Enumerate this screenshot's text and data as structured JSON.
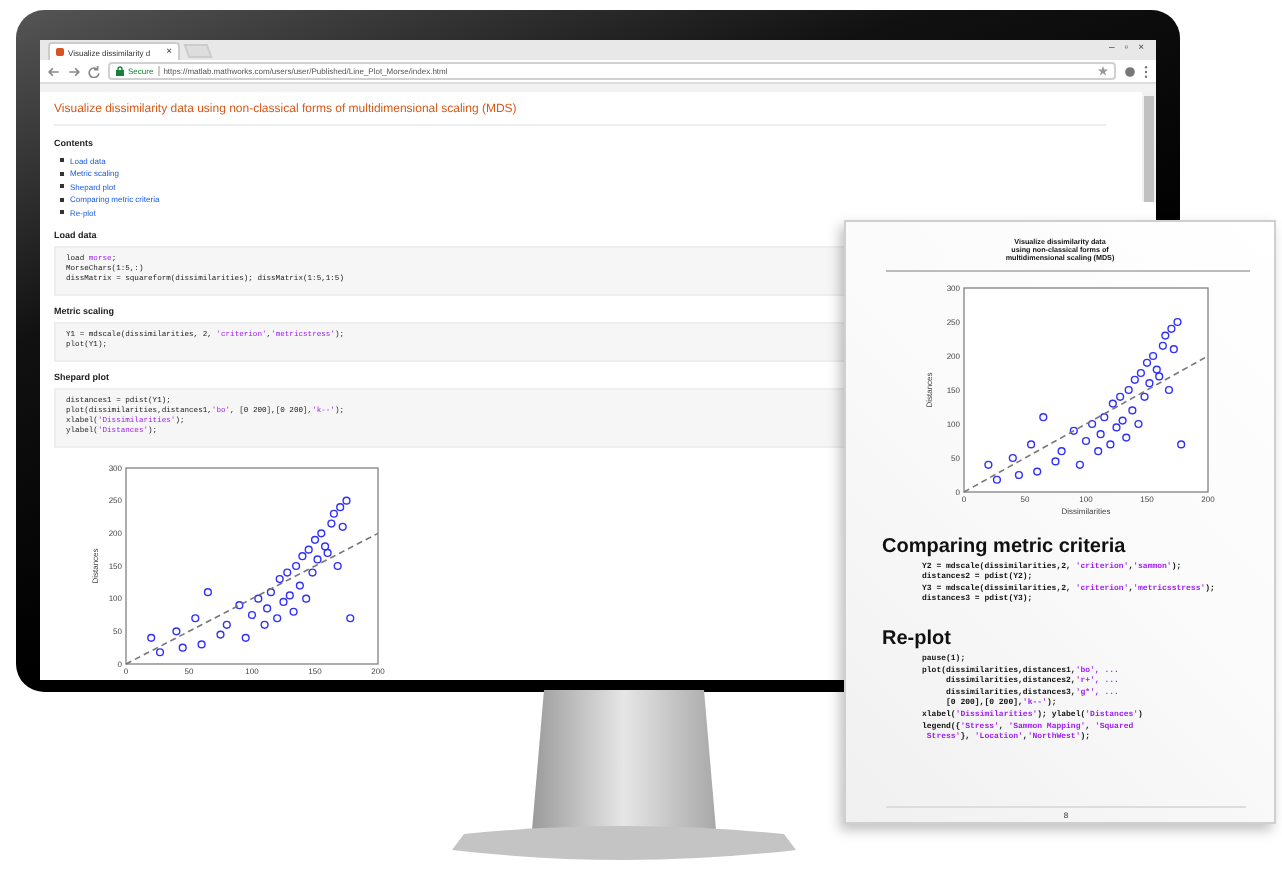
{
  "browser": {
    "tab": {
      "title": "Visualize dissimilarity d",
      "close": "×"
    },
    "window_controls": [
      "–",
      "▫",
      "×"
    ],
    "address": {
      "secure_label": "Secure",
      "url": "https://matlab.mathworks.com/users/user/Published/Line_Plot_Morse/index.html"
    }
  },
  "page": {
    "title": "Visualize dissimilarity data using non-classical forms of multidimensional scaling (MDS)",
    "contents_heading": "Contents",
    "contents": [
      "Load data",
      "Metric scaling",
      "Shepard plot",
      "Comparing metric criteria",
      "Re-plot"
    ],
    "sections": [
      {
        "heading": "Load data",
        "code": [
          [
            {
              "text": "load ",
              "kind": "plain"
            },
            {
              "text": "morse",
              "kind": "string"
            },
            {
              "text": ";",
              "kind": "plain"
            }
          ],
          [
            {
              "text": "MorseChars(1:5,:)",
              "kind": "plain"
            }
          ],
          [
            {
              "text": "dissMatrix = squareform(dissimilarities); dissMatrix(1:5,1:5)",
              "kind": "plain"
            }
          ]
        ]
      },
      {
        "heading": "Metric scaling",
        "code": [
          [
            {
              "text": "Y1 = mdscale(dissimilarities, 2, ",
              "kind": "plain"
            },
            {
              "text": "'criterion'",
              "kind": "string"
            },
            {
              "text": ",",
              "kind": "plain"
            },
            {
              "text": "'metricstress'",
              "kind": "string"
            },
            {
              "text": ");",
              "kind": "plain"
            }
          ],
          [
            {
              "text": "plot(Y1);",
              "kind": "plain"
            }
          ]
        ]
      },
      {
        "heading": "Shepard plot",
        "code": [
          [
            {
              "text": "distances1 = pdist(Y1);",
              "kind": "plain"
            }
          ],
          [
            {
              "text": "plot(dissimilarities,distances1,",
              "kind": "plain"
            },
            {
              "text": "'bo'",
              "kind": "string"
            },
            {
              "text": ", [0 200],[0 200],",
              "kind": "plain"
            },
            {
              "text": "'k--'",
              "kind": "string"
            },
            {
              "text": ");",
              "kind": "plain"
            }
          ],
          [
            {
              "text": "xlabel(",
              "kind": "plain"
            },
            {
              "text": "'Dissimilarities'",
              "kind": "string"
            },
            {
              "text": ");",
              "kind": "plain"
            }
          ],
          [
            {
              "text": "ylabel(",
              "kind": "plain"
            },
            {
              "text": "'Distances'",
              "kind": "string"
            },
            {
              "text": ");",
              "kind": "plain"
            }
          ]
        ]
      }
    ],
    "chart_data": {
      "type": "scatter",
      "ylabel": "Distances",
      "xlim": [
        0,
        200
      ],
      "ylim": [
        0,
        300
      ],
      "xticks": [
        0,
        50,
        100,
        150,
        200
      ],
      "yticks": [
        0,
        50,
        100,
        150,
        200,
        250,
        300
      ],
      "x": [
        0,
        20,
        27,
        40,
        45,
        55,
        60,
        65,
        75,
        80,
        90,
        95,
        100,
        105,
        110,
        112,
        115,
        120,
        122,
        125,
        128,
        130,
        133,
        135,
        138,
        140,
        143,
        145,
        148,
        150,
        152,
        155,
        158,
        160,
        163,
        165,
        168,
        170,
        172,
        175,
        178,
        200
      ],
      "series": [
        {
          "color": "#2f2fff",
          "values": [
            null,
            40,
            18,
            50,
            25,
            70,
            30,
            110,
            45,
            60,
            90,
            40,
            75,
            100,
            60,
            85,
            110,
            70,
            130,
            95,
            140,
            105,
            80,
            150,
            120,
            165,
            100,
            175,
            140,
            190,
            160,
            200,
            180,
            170,
            215,
            230,
            150,
            240,
            210,
            250,
            70,
            null
          ]
        },
        {
          "type": "line",
          "line_style": "dashed",
          "color": "#777777",
          "values": [
            0,
            20,
            27,
            40,
            45,
            55,
            60,
            65,
            75,
            80,
            90,
            95,
            100,
            105,
            110,
            112,
            115,
            120,
            122,
            125,
            128,
            130,
            133,
            135,
            138,
            140,
            143,
            145,
            148,
            150,
            152,
            155,
            158,
            160,
            163,
            165,
            168,
            170,
            172,
            175,
            178,
            200
          ]
        }
      ]
    }
  },
  "paper": {
    "title": "Visualize dissimilarity data using non-classical forms of multidimensional scaling (MDS)",
    "chart_data": {
      "type": "scatter",
      "xlabel": "Dissimilarities",
      "ylabel": "Distances",
      "xlim": [
        0,
        200
      ],
      "ylim": [
        0,
        300
      ],
      "xticks": [
        0,
        50,
        100,
        150,
        200
      ],
      "yticks": [
        0,
        50,
        100,
        150,
        200,
        250,
        300
      ],
      "x": [
        0,
        20,
        27,
        40,
        45,
        55,
        60,
        65,
        75,
        80,
        90,
        95,
        100,
        105,
        110,
        112,
        115,
        120,
        122,
        125,
        128,
        130,
        133,
        135,
        138,
        140,
        143,
        145,
        148,
        150,
        152,
        155,
        158,
        160,
        163,
        165,
        168,
        170,
        172,
        175,
        178,
        200
      ],
      "series": [
        {
          "color": "#2f2fff",
          "values": [
            null,
            40,
            18,
            50,
            25,
            70,
            30,
            110,
            45,
            60,
            90,
            40,
            75,
            100,
            60,
            85,
            110,
            70,
            130,
            95,
            140,
            105,
            80,
            150,
            120,
            165,
            100,
            175,
            140,
            190,
            160,
            200,
            180,
            170,
            215,
            230,
            150,
            240,
            210,
            250,
            70,
            null
          ]
        },
        {
          "type": "line",
          "line_style": "dashed",
          "color": "#777777",
          "values": [
            0,
            20,
            27,
            40,
            45,
            55,
            60,
            65,
            75,
            80,
            90,
            95,
            100,
            105,
            110,
            112,
            115,
            120,
            122,
            125,
            128,
            130,
            133,
            135,
            138,
            140,
            143,
            145,
            148,
            150,
            152,
            155,
            158,
            160,
            163,
            165,
            168,
            170,
            172,
            175,
            178,
            200
          ]
        }
      ]
    },
    "sections": [
      {
        "heading": "Comparing metric criteria",
        "code": [
          [
            {
              "text": "Y2 = mdscale(dissimilarities,2, ",
              "kind": "plain"
            },
            {
              "text": "'criterion'",
              "kind": "string"
            },
            {
              "text": ",",
              "kind": "plain"
            },
            {
              "text": "'sammon'",
              "kind": "string"
            },
            {
              "text": ");",
              "kind": "plain"
            }
          ],
          [
            {
              "text": "distances2 = pdist(Y2);",
              "kind": "plain"
            }
          ],
          [
            {
              "text": "Y3 = mdscale(dissimilarities,2, ",
              "kind": "plain"
            },
            {
              "text": "'criterion'",
              "kind": "string"
            },
            {
              "text": ",",
              "kind": "plain"
            },
            {
              "text": "'metricsstress'",
              "kind": "string"
            },
            {
              "text": ");",
              "kind": "plain"
            }
          ],
          [
            {
              "text": "distances3 = pdist(Y3);",
              "kind": "plain"
            }
          ]
        ]
      },
      {
        "heading": "Re-plot",
        "code": [
          [
            {
              "text": "pause(1);",
              "kind": "plain"
            }
          ],
          [
            {
              "text": "plot(dissimilarities,distances1,",
              "kind": "plain"
            },
            {
              "text": "'bo'",
              "kind": "string"
            },
            {
              "text": ", ...",
              "kind": "string"
            }
          ],
          [
            {
              "text": "     dissimilarities,distances2,",
              "kind": "plain"
            },
            {
              "text": "'r+'",
              "kind": "string"
            },
            {
              "text": ", ...",
              "kind": "string"
            }
          ],
          [
            {
              "text": "     dissimilarities,distances3,",
              "kind": "plain"
            },
            {
              "text": "'g*'",
              "kind": "string"
            },
            {
              "text": ", ...",
              "kind": "string"
            }
          ],
          [
            {
              "text": "     [0 200],[0 200],",
              "kind": "plain"
            },
            {
              "text": "'k--'",
              "kind": "string"
            },
            {
              "text": ");",
              "kind": "plain"
            }
          ],
          [
            {
              "text": "xlabel(",
              "kind": "plain"
            },
            {
              "text": "'Dissimilarities'",
              "kind": "string"
            },
            {
              "text": "); ylabel(",
              "kind": "plain"
            },
            {
              "text": "'Distances'",
              "kind": "string"
            },
            {
              "text": ")",
              "kind": "plain"
            }
          ],
          [
            {
              "text": "legend({",
              "kind": "plain"
            },
            {
              "text": "'Stress'",
              "kind": "string"
            },
            {
              "text": ", ",
              "kind": "plain"
            },
            {
              "text": "'Sammon Mapping'",
              "kind": "string"
            },
            {
              "text": ", ",
              "kind": "plain"
            },
            {
              "text": "'Squared",
              "kind": "string"
            }
          ],
          [
            {
              "text": " Stress'",
              "kind": "string"
            },
            {
              "text": "}, ",
              "kind": "plain"
            },
            {
              "text": "'Location'",
              "kind": "string"
            },
            {
              "text": ",",
              "kind": "plain"
            },
            {
              "text": "'NorthWest'",
              "kind": "string"
            },
            {
              "text": ");",
              "kind": "plain"
            }
          ]
        ]
      }
    ],
    "page_number": "8"
  }
}
